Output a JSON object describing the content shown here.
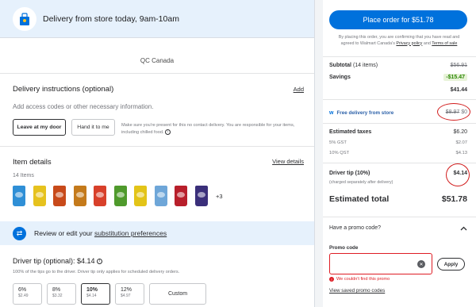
{
  "delivery": {
    "title": "Delivery from store today, 9am-10am"
  },
  "store": {
    "name": "QC Canada"
  },
  "instructions": {
    "title": "Delivery instructions (optional)",
    "add_label": "Add",
    "placeholder": "Add access codes or other necessary information.",
    "leave_label": "Leave at my door",
    "hand_label": "Hand it to me",
    "note": "Make sure you're present for this no contact delivery. You are responsible for your items, including chilled food."
  },
  "items": {
    "title": "Item details",
    "view_label": "View details",
    "count": "14 Items",
    "thumbs": [
      {
        "color": "#2f8fd6",
        "icon": "chip-bag-icon"
      },
      {
        "color": "#e6c21e",
        "icon": "chip-bag-icon"
      },
      {
        "color": "#c84a1a",
        "icon": "chip-bag-icon"
      },
      {
        "color": "#c47a1b",
        "icon": "chip-bag-icon"
      },
      {
        "color": "#d8402a",
        "icon": "chip-bag-icon"
      },
      {
        "color": "#4f9a2c",
        "icon": "chip-bag-icon"
      },
      {
        "color": "#e3c418",
        "icon": "chip-bag-icon"
      },
      {
        "color": "#6ea6d8",
        "icon": "chip-bag-icon"
      },
      {
        "color": "#b81f2b",
        "icon": "chip-bag-icon"
      },
      {
        "color": "#3a2f7a",
        "icon": "chip-bag-icon"
      }
    ],
    "more": "+3"
  },
  "substitution": {
    "prefix": "Review or edit your ",
    "link": "substitution preferences"
  },
  "tip": {
    "title": "Driver tip (optional): $4.14",
    "note": "100% of the tips go to the driver. Driver tip only applies for scheduled delivery orders.",
    "options": [
      {
        "pct": "6%",
        "amt": "$2.49"
      },
      {
        "pct": "8%",
        "amt": "$3.32"
      },
      {
        "pct": "10%",
        "amt": "$4.14"
      },
      {
        "pct": "12%",
        "amt": "$4.97"
      }
    ],
    "custom_label": "Custom"
  },
  "summary": {
    "place_order_label": "Place order for $51.78",
    "terms_prefix": "By placing this order, you are confirming that you have read and agreed to Walmart Canada's ",
    "privacy_link": "Privacy policy",
    "terms_and": " and ",
    "terms_link": "Terms of sale",
    "subtotal_label": "Subtotal",
    "subtotal_count": "(14 items)",
    "subtotal_original": "$56.91",
    "savings_label": "Savings",
    "savings_value": "-$15.47",
    "subtotal_after": "$41.44",
    "free_delivery_label": "Free delivery from store",
    "delivery_original": "$8.97",
    "delivery_now": "$0",
    "taxes_label": "Estimated taxes",
    "taxes_value": "$6.20",
    "gst_label": "5% GST",
    "gst_value": "$2.07",
    "qst_label": "10% QST",
    "qst_value": "$4.13",
    "tip_label": "Driver tip (10%)",
    "tip_note": "(charged separately after delivery)",
    "tip_value": "$4.14",
    "total_label": "Estimated total",
    "total_value": "$51.78"
  },
  "promo": {
    "question": "Have a promo code?",
    "field_label": "Promo code",
    "apply_label": "Apply",
    "error": "We couldn't find this promo",
    "saved_link": "View saved promo codes"
  },
  "colors": {
    "accent": "#0071dc",
    "savings_green": "#2a8703",
    "error_red": "#de1c24",
    "annotation_red": "#d11b1b"
  }
}
